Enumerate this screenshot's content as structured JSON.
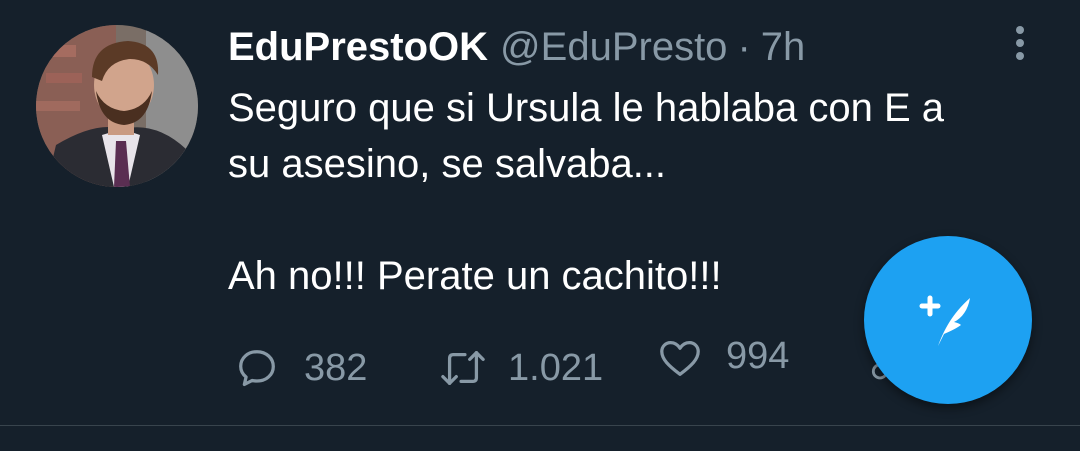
{
  "tweet": {
    "display_name": "EduPrestoOK",
    "handle": "@EduPresto",
    "separator": "·",
    "time": "7h",
    "text_lines": [
      "Seguro que si Ursula le hablaba con E a",
      "su asesino, se salvaba...",
      "Ah no!!! Perate un cachito!!!"
    ],
    "stats": {
      "replies": "382",
      "retweets": "1.021",
      "likes": "994"
    }
  },
  "icons": {
    "avatar": "profile-photo",
    "more": "vertical-ellipsis-icon",
    "reply": "speech-bubble-icon",
    "retweet": "retweet-arrows-icon",
    "like": "heart-outline-icon",
    "share": "share-icon",
    "compose": "feather-plus-icon"
  },
  "colors": {
    "background": "#15202b",
    "secondary_text": "#8899a6",
    "accent": "#1da1f2",
    "divider": "#38444d"
  }
}
